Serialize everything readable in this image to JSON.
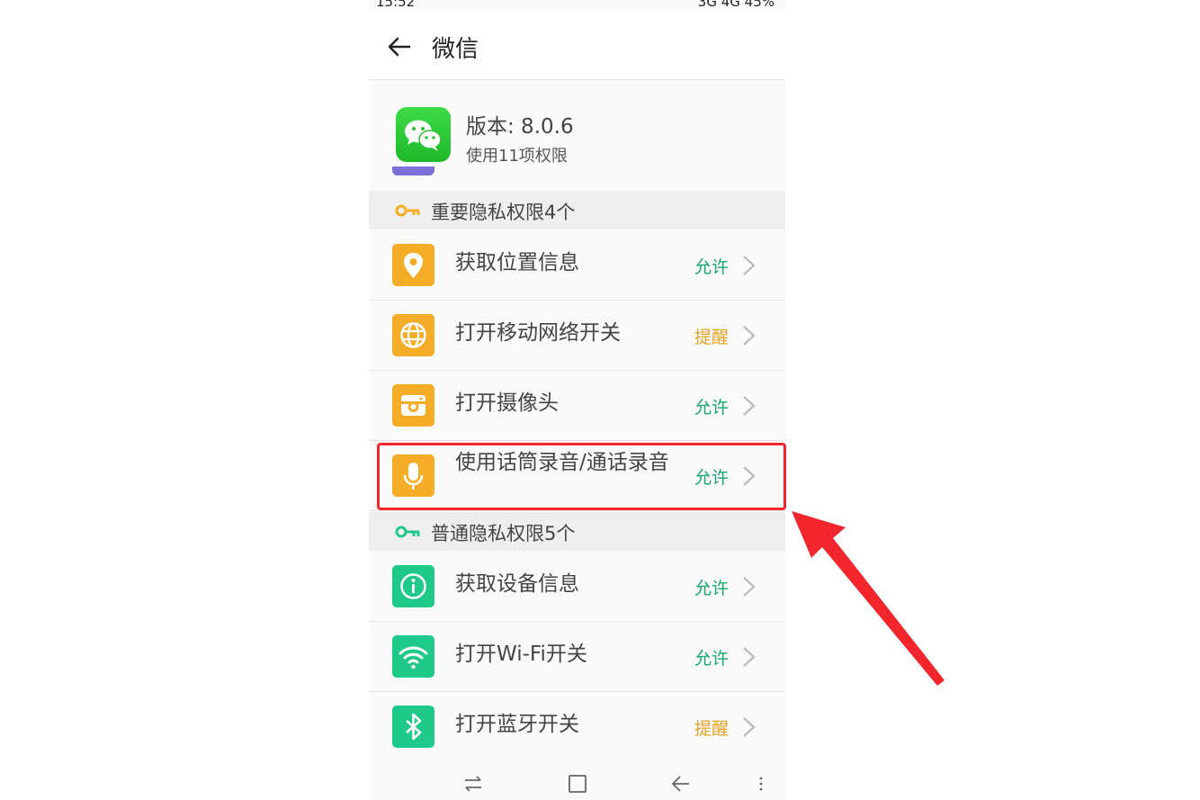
{
  "status_bar": {
    "time": "15:52",
    "indicators": "3G 4G 45%"
  },
  "app_bar": {
    "back_icon": "arrow-left-icon",
    "title": "微信"
  },
  "app_info": {
    "icon": "wechat-icon",
    "version": "版本: 8.0.6",
    "permission_count": "使用11项权限"
  },
  "important_section": {
    "icon": "key-icon",
    "icon_color": "#f5ad28",
    "title": "重要隐私权限4个",
    "items": [
      {
        "icon": "location-pin-icon",
        "label": "获取位置信息",
        "status": "允许"
      },
      {
        "icon": "globe-icon",
        "label": "打开移动网络开关",
        "status": "提醒"
      },
      {
        "icon": "camera-icon",
        "label": "打开摄像头",
        "status": "允许"
      },
      {
        "icon": "microphone-icon",
        "label": "使用话筒录音/通话录音",
        "status": "允许"
      }
    ]
  },
  "normal_section": {
    "icon": "key-icon",
    "icon_color": "#1ec98a",
    "title": "普通隐私权限5个",
    "items": [
      {
        "icon": "info-icon",
        "label": "获取设备信息",
        "status": "允许"
      },
      {
        "icon": "wifi-icon",
        "label": "打开Wi-Fi开关",
        "status": "允许"
      },
      {
        "icon": "bluetooth-icon",
        "label": "打开蓝牙开关",
        "status": "提醒"
      }
    ]
  },
  "colors": {
    "allow": "#14a86c",
    "remind": "#e6a321",
    "annotation": "#f4262d"
  },
  "nav_bar": {
    "icons": [
      "switch-icon",
      "square-home-icon",
      "back-arrow-icon",
      "menu-icon"
    ]
  }
}
